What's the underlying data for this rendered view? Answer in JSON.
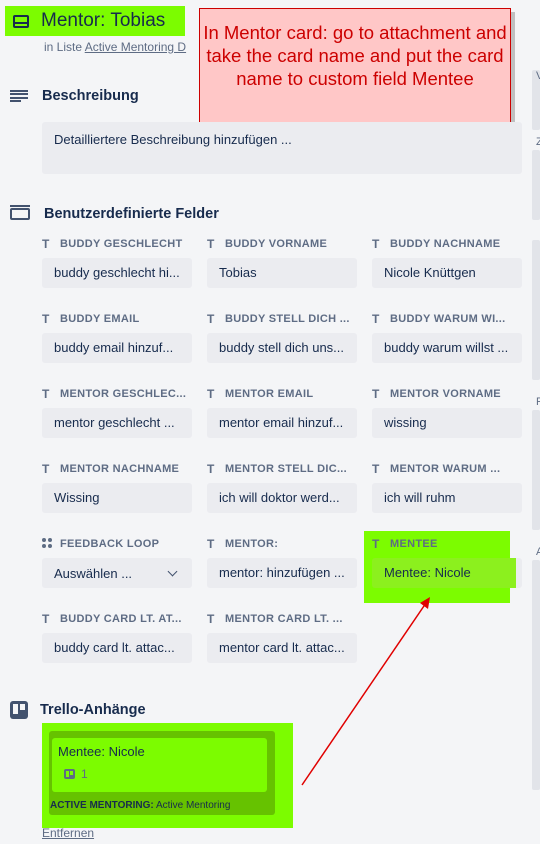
{
  "card": {
    "title": "Mentor: Tobias",
    "list_prefix": "in Liste",
    "list_name": "Active Mentoring D"
  },
  "callout_text": "In Mentor card: go to attachment and take the card name and put the card name to custom field Mentee",
  "description": {
    "heading": "Beschreibung",
    "placeholder": "Detailliertere Beschreibung hinzufügen ..."
  },
  "custom_fields": {
    "heading": "Benutzerdefinierte Felder",
    "fields": [
      {
        "label": "BUDDY GESCHLECHT",
        "value": "buddy geschlecht hi...",
        "icon": "text-type-icon"
      },
      {
        "label": "BUDDY VORNAME",
        "value": "Tobias",
        "icon": "text-type-icon"
      },
      {
        "label": "BUDDY NACHNAME",
        "value": "Nicole Knüttgen",
        "icon": "text-type-icon"
      },
      {
        "label": "BUDDY EMAIL",
        "value": "buddy email hinzuf...",
        "icon": "text-type-icon"
      },
      {
        "label": "BUDDY STELL DICH ...",
        "value": "buddy stell dich uns...",
        "icon": "text-type-icon"
      },
      {
        "label": "BUDDY WARUM WI...",
        "value": "buddy warum willst ...",
        "icon": "text-type-icon"
      },
      {
        "label": "MENTOR GESCHLEC...",
        "value": "mentor geschlecht ...",
        "icon": "text-type-icon"
      },
      {
        "label": "MENTOR EMAIL",
        "value": "mentor email hinzuf...",
        "icon": "text-type-icon"
      },
      {
        "label": "MENTOR VORNAME",
        "value": "wissing",
        "icon": "text-type-icon"
      },
      {
        "label": "MENTOR NACHNAME",
        "value": "Wissing",
        "icon": "text-type-icon"
      },
      {
        "label": "MENTOR STELL DIC...",
        "value": "ich will doktor werd...",
        "icon": "text-type-icon"
      },
      {
        "label": "MENTOR WARUM ...",
        "value": "ich will ruhm",
        "icon": "text-type-icon"
      },
      {
        "label": "FEEDBACK LOOP",
        "value": "Auswählen ...",
        "icon": "dropdown-type-icon"
      },
      {
        "label": "MENTOR:",
        "value": "mentor: hinzufügen ...",
        "icon": "text-type-icon"
      },
      {
        "label": "MENTEE",
        "value": "Mentee: Nicole",
        "icon": "text-type-icon"
      },
      {
        "label": "BUDDY CARD LT. AT...",
        "value": "buddy card lt. attac...",
        "icon": "text-type-icon"
      },
      {
        "label": "MENTOR CARD LT. ...",
        "value": "mentor card lt. attac...",
        "icon": "text-type-icon"
      }
    ]
  },
  "attachments": {
    "heading": "Trello-Anhänge",
    "card_name": "Mentee: Nicole",
    "badge_count": "1",
    "board_label": "ACTIVE MENTORING:",
    "board_value": "Active Mentoring",
    "remove_label": "Entfernen"
  },
  "t_glyph": "T",
  "edge_letters": [
    "V",
    "Z",
    "P",
    "A"
  ],
  "colors": {
    "highlight": "#7cfc00",
    "callout_bg": "#ffc7c7",
    "callout_text": "#cc0000",
    "arrow": "#e00000"
  }
}
